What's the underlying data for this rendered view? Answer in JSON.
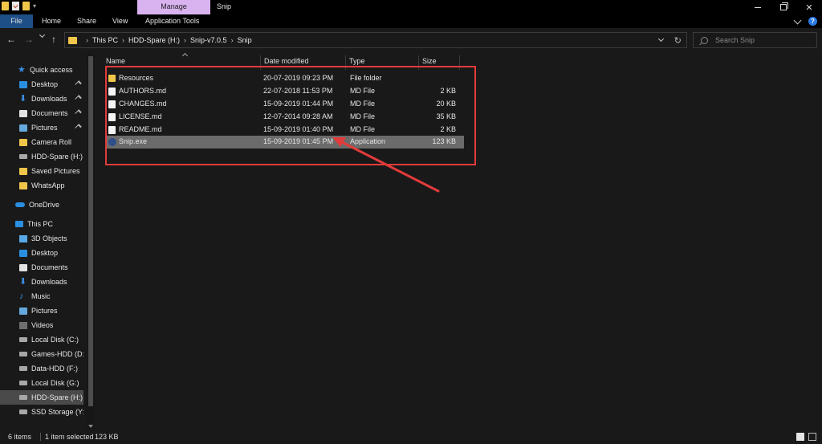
{
  "window": {
    "title": "Snip",
    "context_tab": "Manage"
  },
  "ribbon": {
    "tabs": [
      "File",
      "Home",
      "Share",
      "View",
      "Application Tools"
    ]
  },
  "address": {
    "crumbs": [
      "This PC",
      "HDD-Spare (H:)",
      "Snip-v7.0.5",
      "Snip"
    ]
  },
  "search": {
    "placeholder": "Search Snip"
  },
  "sidebar": {
    "items": [
      {
        "label": "Quick access",
        "icon": "star-icon"
      },
      {
        "label": "Desktop",
        "icon": "desktop-icon"
      },
      {
        "label": "Downloads",
        "icon": "download-icon"
      },
      {
        "label": "Documents",
        "icon": "documents-icon"
      },
      {
        "label": "Pictures",
        "icon": "pictures-icon"
      },
      {
        "label": "Camera Roll",
        "icon": "folder-icon"
      },
      {
        "label": "HDD-Spare (H:)",
        "icon": "drive-icon"
      },
      {
        "label": "Saved Pictures",
        "icon": "folder-icon"
      },
      {
        "label": "WhatsApp",
        "icon": "folder-icon"
      },
      {
        "label": "OneDrive",
        "icon": "cloud-icon"
      },
      {
        "label": "This PC",
        "icon": "computer-icon"
      },
      {
        "label": "3D Objects",
        "icon": "cube-icon"
      },
      {
        "label": "Desktop",
        "icon": "desktop-icon"
      },
      {
        "label": "Documents",
        "icon": "documents-icon"
      },
      {
        "label": "Downloads",
        "icon": "download-icon"
      },
      {
        "label": "Music",
        "icon": "music-icon"
      },
      {
        "label": "Pictures",
        "icon": "pictures-icon"
      },
      {
        "label": "Videos",
        "icon": "videos-icon"
      },
      {
        "label": "Local Disk (C:)",
        "icon": "drive-icon"
      },
      {
        "label": "Games-HDD (D:)",
        "icon": "drive-icon"
      },
      {
        "label": "Data-HDD (F:)",
        "icon": "drive-icon"
      },
      {
        "label": "Local Disk (G:)",
        "icon": "drive-icon"
      },
      {
        "label": "HDD-Spare (H:)",
        "icon": "drive-icon"
      },
      {
        "label": "SSD Storage (Y:)",
        "icon": "drive-icon"
      }
    ]
  },
  "columns": {
    "name": "Name",
    "date": "Date modified",
    "type": "Type",
    "size": "Size"
  },
  "files": [
    {
      "name": "Resources",
      "date": "20-07-2019 09:23 PM",
      "type": "File folder",
      "size": "",
      "icon": "folder-icon"
    },
    {
      "name": "AUTHORS.md",
      "date": "22-07-2018 11:53 PM",
      "type": "MD File",
      "size": "2 KB",
      "icon": "file-icon"
    },
    {
      "name": "CHANGES.md",
      "date": "15-09-2019 01:44 PM",
      "type": "MD File",
      "size": "20 KB",
      "icon": "file-icon"
    },
    {
      "name": "LICENSE.md",
      "date": "12-07-2014 09:28 AM",
      "type": "MD File",
      "size": "35 KB",
      "icon": "file-icon"
    },
    {
      "name": "README.md",
      "date": "15-09-2019 01:40 PM",
      "type": "MD File",
      "size": "2 KB",
      "icon": "file-icon"
    },
    {
      "name": "Snip.exe",
      "date": "15-09-2019 01:45 PM",
      "type": "Application",
      "size": "123 KB",
      "icon": "app-icon",
      "selected": true
    }
  ],
  "status": {
    "count": "6 items",
    "selected": "1 item selected",
    "size": "123 KB"
  },
  "colors": {
    "highlight": "#e23b3b",
    "manage_tab": "#d9b3f0",
    "file_tab": "#1e4f86"
  }
}
